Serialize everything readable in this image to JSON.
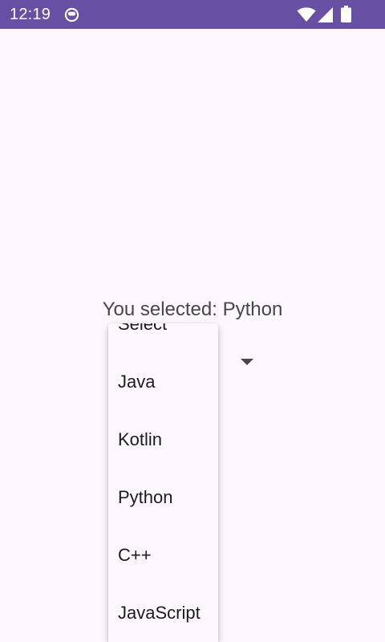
{
  "status_bar": {
    "time": "12:19",
    "icons": [
      "notification-app-icon",
      "wifi-icon",
      "cellular-signal-icon",
      "battery-icon"
    ],
    "background": "#6750A4"
  },
  "main": {
    "selected_text": "You selected: Python"
  },
  "dropdown": {
    "items": [
      "Select",
      "Java",
      "Kotlin",
      "Python",
      "C++",
      "JavaScript"
    ],
    "selected": "Python"
  },
  "colors": {
    "background": "#FEF7FF",
    "text_secondary": "#49454F",
    "text_primary": "#1D1B20"
  }
}
